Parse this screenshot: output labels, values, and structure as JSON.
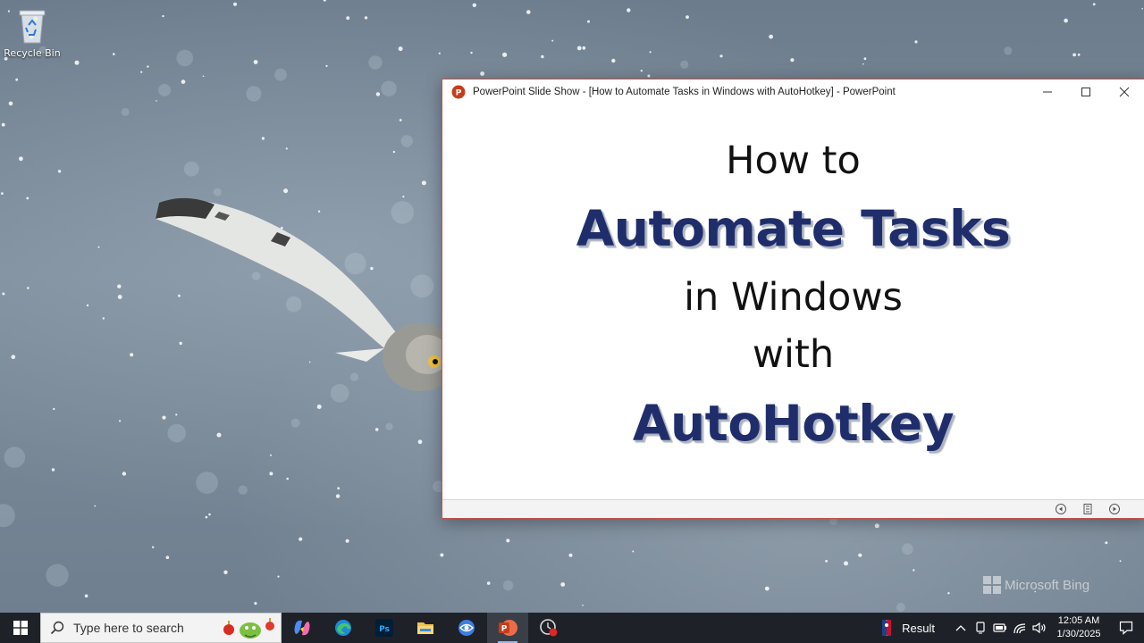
{
  "desktop": {
    "icons": [
      {
        "label": "Recycle Bin",
        "icon": "recycle-bin-icon"
      }
    ],
    "watermark": "Microsoft Bing"
  },
  "window": {
    "title": "PowerPoint Slide Show - [How to Automate Tasks in Windows with AutoHotkey] - PowerPoint",
    "app_icon": "powerpoint-icon",
    "controls": {
      "minimize": "minimize-icon",
      "maximize": "maximize-icon",
      "close": "close-icon"
    },
    "accent": "#c0504d"
  },
  "slide": {
    "line1": "How to",
    "line2": "Automate Tasks",
    "line3": "in Windows",
    "line4": "with",
    "line5": "AutoHotkey",
    "heading_color": "#1f2e6b"
  },
  "slide_nav": {
    "previous": "previous-slide-icon",
    "menu": "slide-menu-icon",
    "next": "next-slide-icon"
  },
  "taskbar": {
    "search_placeholder": "Type here to search",
    "apps": [
      "copilot-icon",
      "edge-icon",
      "photoshop-icon",
      "file-explorer-icon",
      "browser-icon",
      "powerpoint-icon",
      "recorder-icon"
    ],
    "active_app": "powerpoint-icon",
    "tray": {
      "news_label": "Result",
      "time": "12:05 AM",
      "date": "1/30/2025"
    }
  }
}
